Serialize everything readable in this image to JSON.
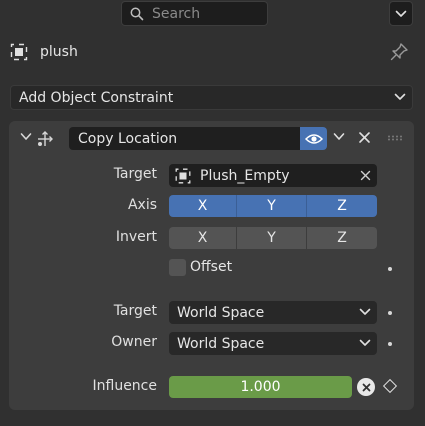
{
  "search": {
    "placeholder": "Search"
  },
  "object": {
    "name": "plush"
  },
  "add_constraint": {
    "label": "Add Object Constraint"
  },
  "constraint": {
    "name": "Copy Location",
    "target_label": "Target",
    "target_value": "Plush_Empty",
    "axis_label": "Axis",
    "axis": [
      "X",
      "Y",
      "Z"
    ],
    "invert_label": "Invert",
    "invert": [
      "X",
      "Y",
      "Z"
    ],
    "offset_label": "Offset",
    "target_space_label": "Target",
    "target_space_value": "World Space",
    "owner_space_label": "Owner",
    "owner_space_value": "World Space",
    "influence_label": "Influence",
    "influence_value": "1.000"
  },
  "colors": {
    "accent": "#4772b3",
    "influence": "#6a9b48",
    "background": "#303030",
    "panel": "#3d3d3d"
  }
}
